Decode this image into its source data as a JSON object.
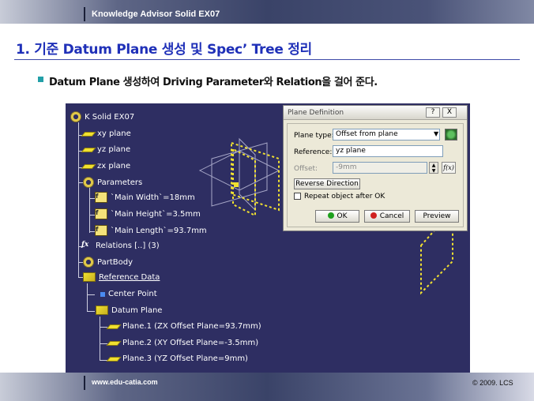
{
  "header": {
    "course": "Knowledge Advisor Solid EX07"
  },
  "slide": {
    "title": "1. 기준  Datum Plane 생성 및 Spec’ Tree 정리",
    "bullet": "Datum Plane 생성하여 Driving Parameter와 Relation을 걸어 준다."
  },
  "tree": {
    "root": "K Solid EX07",
    "xy": "xy plane",
    "yz": "yz plane",
    "zx": "zx plane",
    "parameters": "Parameters",
    "p1": "`Main Width`=18mm",
    "p2": "`Main Height`=3.5mm",
    "p3": "`Main Length`=93.7mm",
    "relations": "Relations [..] (3)",
    "partbody": "PartBody",
    "refdata": "Reference Data",
    "center": "Center Point",
    "datum": "Datum Plane",
    "pl1": "Plane.1 (ZX Offset Plane=93.7mm)",
    "pl2": "Plane.2 (XY Offset Plane=-3.5mm)",
    "pl3": "Plane.3 (YZ Offset Plane=9mm)"
  },
  "dialog": {
    "title": "Plane Definition",
    "help": "?",
    "close": "X",
    "plane_type_label": "Plane type:",
    "plane_type_value": "Offset from plane",
    "reference_label": "Reference:",
    "reference_value": "yz plane",
    "offset_label": "Offset:",
    "offset_value": "-9mm",
    "reverse": "Reverse Direction",
    "repeat": "Repeat object after OK",
    "ok": "OK",
    "cancel": "Cancel",
    "preview": "Preview",
    "fx": "f(x)"
  },
  "footer": {
    "url": "www.edu-catia.com",
    "copyright": "© 2009. LCS"
  },
  "colors": {
    "title": "#1f30b8",
    "panel": "#2e2e62",
    "plane_yellow": "#f0e030",
    "ok_green": "#1ea01e",
    "cancel_red": "#d02020"
  }
}
